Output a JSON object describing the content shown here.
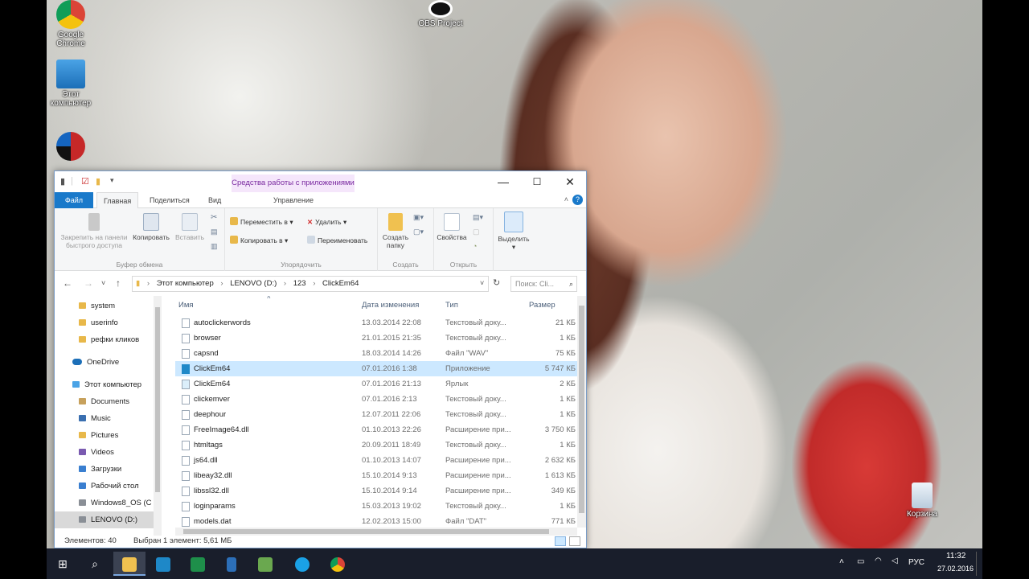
{
  "desktop": {
    "icons": [
      {
        "label": "Google Chrome",
        "icon": "chrome-icon"
      },
      {
        "label": "Этот компьютер",
        "icon": "computer-icon"
      },
      {
        "label": "",
        "icon": "app-icon"
      },
      {
        "label": "OBS Project",
        "icon": "obs-icon"
      },
      {
        "label": "Корзина",
        "icon": "recycle-bin-icon"
      }
    ]
  },
  "window": {
    "context_tab": "Средства работы с приложениями",
    "controls": {
      "minimize": "—",
      "maximize": "☐",
      "close": "✕"
    },
    "tabs": [
      "Файл",
      "Главная",
      "Поделиться",
      "Вид",
      "Управление"
    ],
    "ribbon": {
      "clipboard": {
        "name": "Буфер обмена",
        "pin": "Закрепить на панели быстрого доступа",
        "copy": "Копировать",
        "paste": "Вставить"
      },
      "organize": {
        "name": "Упорядочить",
        "move_to": "Переместить в",
        "copy_to": "Копировать в",
        "delete": "Удалить",
        "rename": "Переименовать"
      },
      "create": {
        "name": "Создать",
        "new_folder": "Создать папку"
      },
      "open": {
        "name": "Открыть",
        "properties": "Свойства"
      },
      "select": {
        "label": "Выделить"
      }
    },
    "address": {
      "crumbs": [
        "Этот компьютер",
        "LENOVO (D:)",
        "123",
        "ClickEm64"
      ],
      "search_placeholder": "Поиск: Cli..."
    },
    "nav": [
      {
        "label": "system",
        "icon": "folder-icon",
        "level": 1
      },
      {
        "label": "userinfo",
        "icon": "folder-icon",
        "level": 1
      },
      {
        "label": "рефки кликов",
        "icon": "folder-icon",
        "level": 1
      },
      {
        "label": "OneDrive",
        "icon": "onedrive-icon",
        "level": 0
      },
      {
        "label": "Этот компьютер",
        "icon": "computer-icon",
        "level": 0
      },
      {
        "label": "Documents",
        "icon": "documents-icon",
        "level": 1
      },
      {
        "label": "Music",
        "icon": "music-icon",
        "level": 1
      },
      {
        "label": "Pictures",
        "icon": "pictures-icon",
        "level": 1
      },
      {
        "label": "Videos",
        "icon": "videos-icon",
        "level": 1
      },
      {
        "label": "Загрузки",
        "icon": "downloads-icon",
        "level": 1
      },
      {
        "label": "Рабочий стол",
        "icon": "desktop-icon",
        "level": 1
      },
      {
        "label": "Windows8_OS (C",
        "icon": "drive-icon",
        "level": 1
      },
      {
        "label": "LENOVO (D:)",
        "icon": "drive-icon",
        "level": 1,
        "selected": true
      }
    ],
    "columns": {
      "name": "Имя",
      "date": "Дата изменения",
      "type": "Тип",
      "size": "Размер"
    },
    "files": [
      {
        "name": "autoclickerwords",
        "date": "13.03.2014 22:08",
        "type": "Текстовый доку...",
        "size": "21 КБ"
      },
      {
        "name": "browser",
        "date": "21.01.2015 21:35",
        "type": "Текстовый доку...",
        "size": "1 КБ"
      },
      {
        "name": "capsnd",
        "date": "18.03.2014 14:26",
        "type": "Файл \"WAV\"",
        "size": "75 КБ"
      },
      {
        "name": "ClickEm64",
        "date": "07.01.2016 1:38",
        "type": "Приложение",
        "size": "5 747 КБ",
        "selected": true
      },
      {
        "name": "ClickEm64",
        "date": "07.01.2016 21:13",
        "type": "Ярлык",
        "size": "2 КБ"
      },
      {
        "name": "clickemver",
        "date": "07.01.2016 2:13",
        "type": "Текстовый доку...",
        "size": "1 КБ"
      },
      {
        "name": "deephour",
        "date": "12.07.2011 22:06",
        "type": "Текстовый доку...",
        "size": "1 КБ"
      },
      {
        "name": "FreeImage64.dll",
        "date": "01.10.2013 22:26",
        "type": "Расширение при...",
        "size": "3 750 КБ"
      },
      {
        "name": "htmltags",
        "date": "20.09.2011 18:49",
        "type": "Текстовый доку...",
        "size": "1 КБ"
      },
      {
        "name": "js64.dll",
        "date": "01.10.2013 14:07",
        "type": "Расширение при...",
        "size": "2 632 КБ"
      },
      {
        "name": "libeay32.dll",
        "date": "15.10.2014 9:13",
        "type": "Расширение при...",
        "size": "1 613 КБ"
      },
      {
        "name": "libssl32.dll",
        "date": "15.10.2014 9:14",
        "type": "Расширение при...",
        "size": "349 КБ"
      },
      {
        "name": "loginparams",
        "date": "15.03.2013 19:02",
        "type": "Текстовый доку...",
        "size": "1 КБ"
      },
      {
        "name": "models.dat",
        "date": "12.02.2013 15:00",
        "type": "Файл \"DAT\"",
        "size": "771 КБ"
      }
    ],
    "status": {
      "count": "Элементов: 40",
      "selected": "Выбран 1 элемент: 5,61 МБ"
    }
  },
  "taskbar": {
    "apps": [
      "start-icon",
      "search-icon",
      "explorer-icon",
      "clickem-icon",
      "excel-icon",
      "app-icon",
      "green-app-icon",
      "skype-icon",
      "chrome-icon"
    ],
    "lang": "РУС",
    "time": "11:32",
    "date": "27.02.2016"
  }
}
